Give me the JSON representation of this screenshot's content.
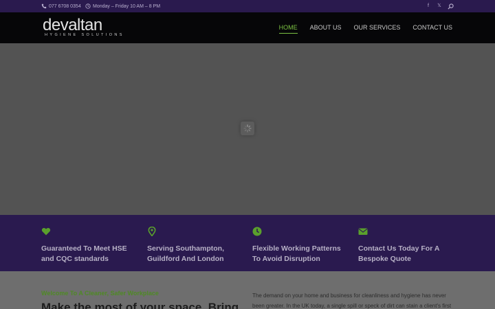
{
  "topbar": {
    "phone": "077 6708 0354",
    "hours": "Monday – Friday 10 AM – 8 PM",
    "social": [
      "facebook-icon",
      "x-icon",
      "search-icon"
    ]
  },
  "header": {
    "logo_word": "devaltan",
    "logo_tag": "HYGIENE SOLUTIONS",
    "nav": [
      {
        "label": "HOME",
        "active": true
      },
      {
        "label": "ABOUT US",
        "active": false
      },
      {
        "label": "OUR SERVICES",
        "active": false
      },
      {
        "label": "CONTACT US",
        "active": false
      }
    ]
  },
  "features": [
    {
      "icon": "heart-icon",
      "text": "Guaranteed To Meet HSE and CQC standards"
    },
    {
      "icon": "map-pin-icon",
      "text": "Serving Southampton, Guildford And London"
    },
    {
      "icon": "clock-icon",
      "text": "Flexible Working Patterns To Avoid Disruption"
    },
    {
      "icon": "envelope-icon",
      "text": "Contact Us Today For A Bespoke Quote"
    }
  ],
  "content": {
    "welcome": "Welcome To A Cleaner, Safer Workplace",
    "headline": "Make the most of your space. Bring",
    "paragraph": "The demand on your home and business for cleanliness and hygiene has never been greater. In the UK today, a single spill or speck of dirt can stain a client's first"
  },
  "colors": {
    "accent": "#7bc142",
    "topbar_bg": "#2a1a4e",
    "header_bg": "#060608",
    "band_bg": "#2a1a4f"
  }
}
